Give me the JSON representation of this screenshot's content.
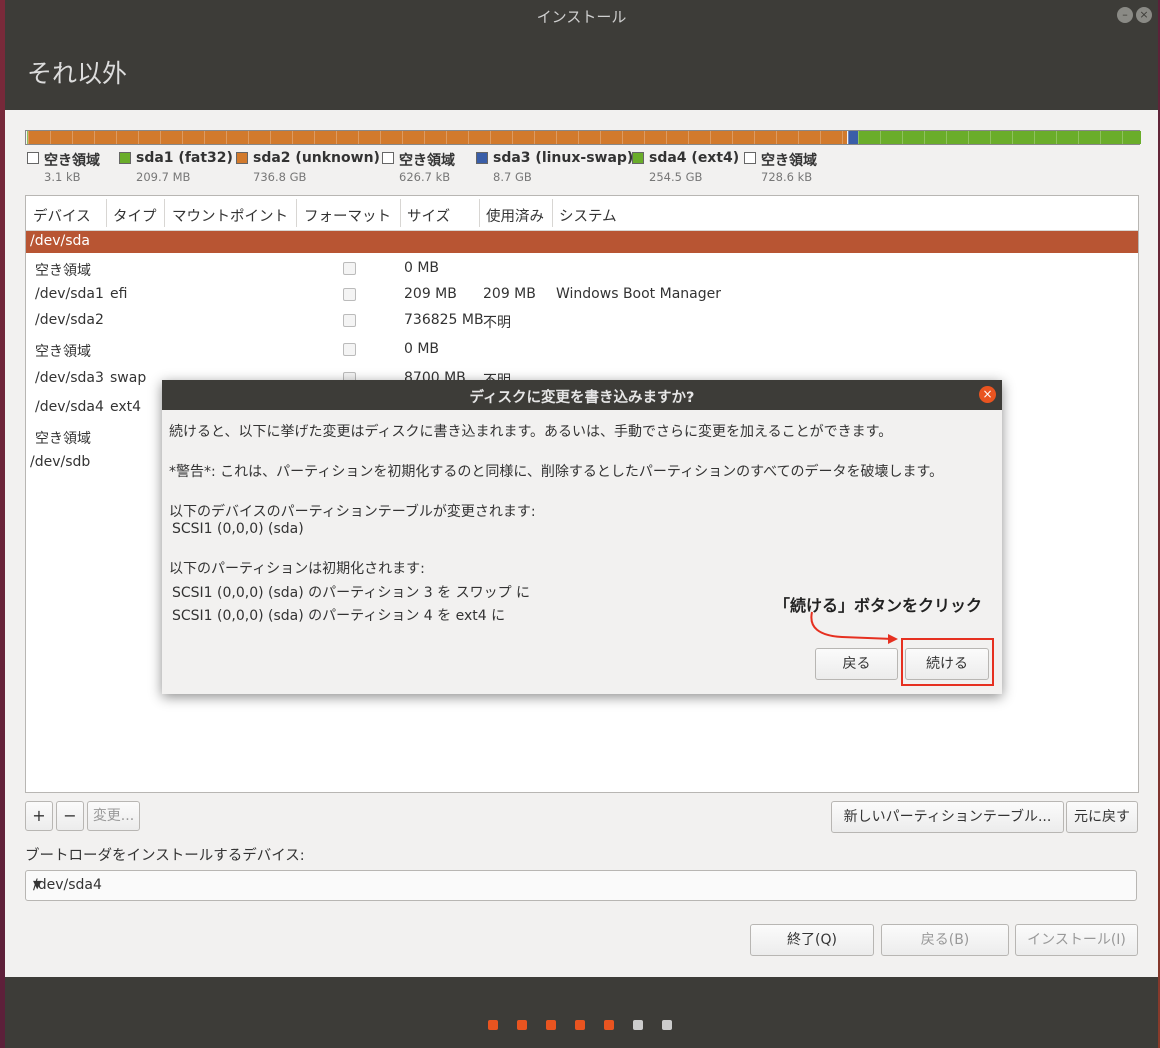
{
  "window": {
    "title": "インストール",
    "page_title": "それ以外",
    "minimize_glyph": "–",
    "close_glyph": "×"
  },
  "partition_bar": [
    {
      "name": "空き領域",
      "color": "#f0f0f0",
      "share": 0.0001
    },
    {
      "name": "sda1",
      "color": "#6aad2a",
      "share": 0.0002
    },
    {
      "name": "sda2",
      "color": "#d27a2c",
      "share": 0.7361
    },
    {
      "name": "空き領域",
      "color": "#f0f0f0",
      "share": 0.0001
    },
    {
      "name": "sda3",
      "color": "#3a5ea8",
      "share": 0.0087
    },
    {
      "name": "sda4",
      "color": "#6aad2a",
      "share": 0.2543
    },
    {
      "name": "空き領域",
      "color": "#f0f0f0",
      "share": 0.0005
    }
  ],
  "legend": [
    {
      "name": "空き領域",
      "size": "3.1 kB",
      "color": "#ffffff"
    },
    {
      "name": "sda1 (fat32)",
      "size": "209.7 MB",
      "color": "#6aad2a"
    },
    {
      "name": "sda2 (unknown)",
      "size": "736.8 GB",
      "color": "#d27a2c"
    },
    {
      "name": "空き領域",
      "size": "626.7 kB",
      "color": "#ffffff"
    },
    {
      "name": "sda3 (linux-swap)",
      "size": "8.7 GB",
      "color": "#3a5ea8"
    },
    {
      "name": "sda4 (ext4)",
      "size": "254.5 GB",
      "color": "#6aad2a"
    },
    {
      "name": "空き領域",
      "size": "728.6 kB",
      "color": "#ffffff"
    }
  ],
  "table": {
    "headers": [
      "デバイス",
      "タイプ",
      "マウントポイント",
      "フォーマット",
      "サイズ",
      "使用済み",
      "システム"
    ],
    "selected_row": "/dev/sda",
    "rows": [
      {
        "device": "空き領域",
        "type": "",
        "size": "0 MB",
        "used": "",
        "system": ""
      },
      {
        "device": "/dev/sda1",
        "type": "efi",
        "size": "209 MB",
        "used": "209 MB",
        "system": "Windows Boot Manager"
      },
      {
        "device": "/dev/sda2",
        "type": "",
        "size": "736825 MB",
        "used": "不明",
        "system": ""
      },
      {
        "device": "空き領域",
        "type": "",
        "size": "0 MB",
        "used": "",
        "system": ""
      },
      {
        "device": "/dev/sda3",
        "type": "swap",
        "size": "8700 MB",
        "used": "不明",
        "system": ""
      },
      {
        "device": "/dev/sda4",
        "type": "ext4",
        "size": "",
        "used": "",
        "system": ""
      },
      {
        "device": "空き領域",
        "type": "",
        "size": "",
        "used": "",
        "system": ""
      }
    ],
    "sdb_row": "/dev/sdb"
  },
  "table_buttons": {
    "add": "+",
    "remove": "−",
    "change": "変更...",
    "new_table": "新しいパーティションテーブル...",
    "revert": "元に戻す"
  },
  "bootloader": {
    "label": "ブートローダをインストールするデバイス:",
    "value": "/dev/sda4",
    "arrow": "▼"
  },
  "nav_buttons": {
    "quit": "終了(Q)",
    "back": "戻る(B)",
    "install": "インストール(I)"
  },
  "progress_dots": [
    {
      "color": "#e95420"
    },
    {
      "color": "#e95420"
    },
    {
      "color": "#e95420"
    },
    {
      "color": "#e95420"
    },
    {
      "color": "#e95420"
    },
    {
      "color": "#cccccc"
    },
    {
      "color": "#cccccc"
    }
  ],
  "dialog": {
    "title": "ディスクに変更を書き込みますか?",
    "close_glyph": "×",
    "line1": "続けると、以下に挙げた変更はディスクに書き込まれます。あるいは、手動でさらに変更を加えることができます。",
    "warning": "*警告*: これは、パーティションを初期化するのと同様に、削除するとしたパーティションのすべてのデータを破壊します。",
    "table_change_label": "以下のデバイスのパーティションテーブルが変更されます:",
    "table_change_device": "SCSI1 (0,0,0) (sda)",
    "format_label": "以下のパーティションは初期化されます:",
    "format_item1": "SCSI1 (0,0,0) (sda) のパーティション 3 を スワップ に",
    "format_item2": "SCSI1 (0,0,0) (sda) のパーティション 4 を ext4 に",
    "back_button": "戻る",
    "continue_button": "続ける"
  },
  "annotation": {
    "text": "「続ける」ボタンをクリック",
    "color": "#e63020"
  }
}
